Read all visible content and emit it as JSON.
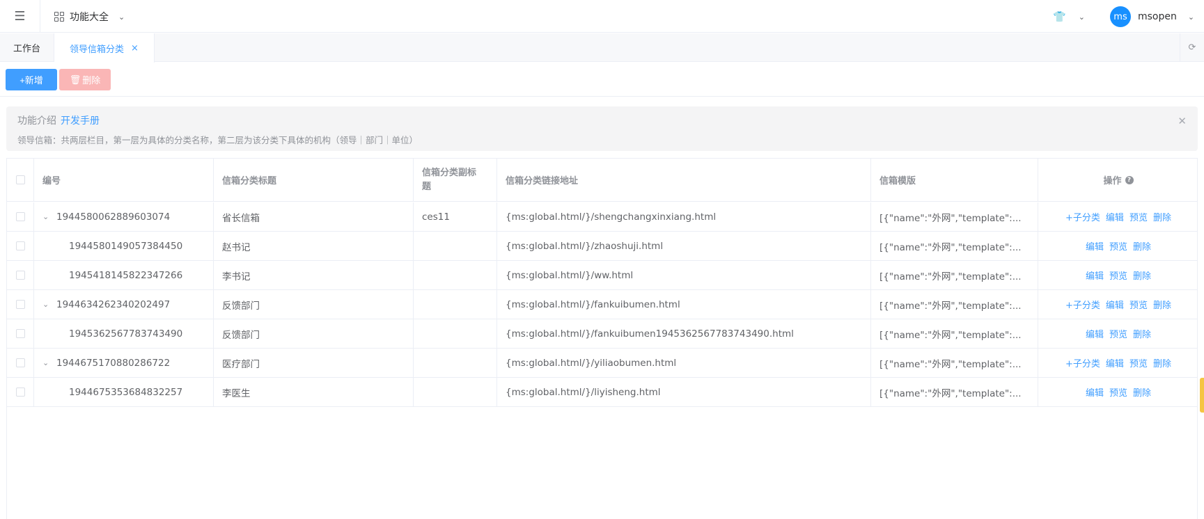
{
  "header": {
    "menu_switch_label": "功能大全",
    "user_name": "msopen",
    "avatar_text": "ms"
  },
  "tabs": [
    {
      "label": "工作台"
    },
    {
      "label": "领导信箱分类"
    }
  ],
  "toolbar": {
    "add_label": "+新增",
    "delete_label": "删除"
  },
  "notice": {
    "title": "功能介绍",
    "link": "开发手册",
    "description": "领导信箱：共两层栏目，第一层为具体的分类名称，第二层为该分类下具体的机构（领导｜部门｜单位）"
  },
  "table": {
    "headers": {
      "id": "编号",
      "title": "信箱分类标题",
      "subtitle": "信箱分类副标题",
      "link": "信箱分类链接地址",
      "template": "信箱模版",
      "ops": "操作"
    },
    "ops_labels": {
      "add_child": "+子分类",
      "edit": "编辑",
      "preview": "预览",
      "delete": "删除"
    },
    "rows": [
      {
        "id": "1944580062889603074",
        "title": "省长信箱",
        "subtitle": "ces11",
        "link": "{ms:global.html/}/shengchangxinxiang.html",
        "template": "[{\"name\":\"外网\",\"template\":...",
        "parent": true
      },
      {
        "id": "1944580149057384450",
        "title": "赵书记",
        "subtitle": "",
        "link": "{ms:global.html/}/zhaoshuji.html",
        "template": "[{\"name\":\"外网\",\"template\":...",
        "parent": false
      },
      {
        "id": "1945418145822347266",
        "title": "李书记",
        "subtitle": "",
        "link": "{ms:global.html/}/ww.html",
        "template": "[{\"name\":\"外网\",\"template\":...",
        "parent": false
      },
      {
        "id": "1944634262340202497",
        "title": "反馈部门",
        "subtitle": "",
        "link": "{ms:global.html/}/fankuibumen.html",
        "template": "[{\"name\":\"外网\",\"template\":...",
        "parent": true
      },
      {
        "id": "1945362567783743490",
        "title": "反馈部门",
        "subtitle": "",
        "link": "{ms:global.html/}/fankuibumen1945362567783743490.html",
        "template": "[{\"name\":\"外网\",\"template\":...",
        "parent": false
      },
      {
        "id": "1944675170880286722",
        "title": "医疗部门",
        "subtitle": "",
        "link": "{ms:global.html/}/yiliaobumen.html",
        "template": "[{\"name\":\"外网\",\"template\":...",
        "parent": true
      },
      {
        "id": "1944675353684832257",
        "title": "李医生",
        "subtitle": "",
        "link": "{ms:global.html/}/liyisheng.html",
        "template": "[{\"name\":\"外网\",\"template\":...",
        "parent": false
      }
    ]
  },
  "colors": {
    "primary": "#409eff",
    "danger_light": "#fab6b6",
    "avatar": "#1890ff"
  }
}
